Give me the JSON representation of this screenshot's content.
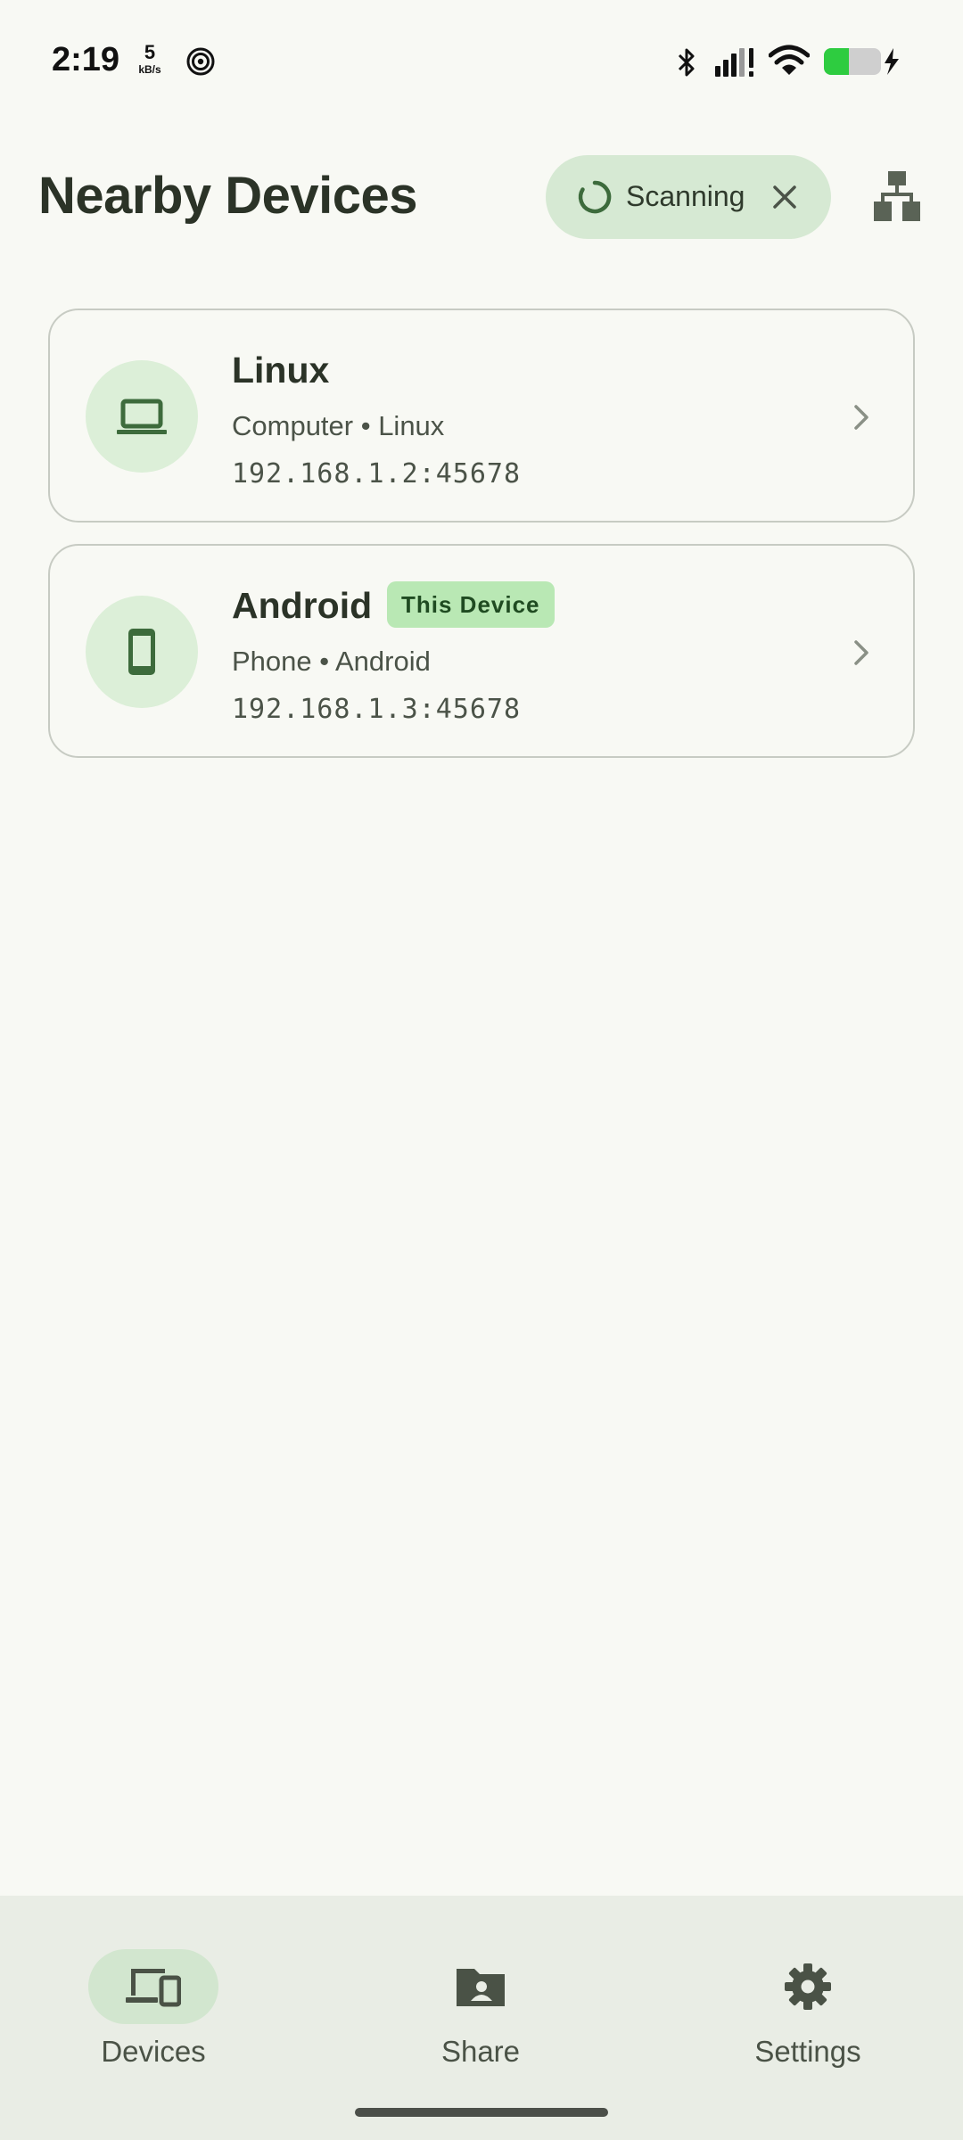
{
  "status_bar": {
    "time": "2:19",
    "net_speed": "5",
    "net_speed_unit": "kB/s"
  },
  "header": {
    "title": "Nearby Devices",
    "scan_label": "Scanning"
  },
  "devices": [
    {
      "name": "Linux",
      "meta": "Computer • Linux",
      "address": "192.168.1.2:45678",
      "icon": "laptop-icon"
    },
    {
      "name": "Android",
      "badge": "This Device",
      "meta": "Phone • Android",
      "address": "192.168.1.3:45678",
      "icon": "phone-icon"
    }
  ],
  "nav": {
    "items": [
      {
        "label": "Devices",
        "icon": "devices-icon",
        "active": true
      },
      {
        "label": "Share",
        "icon": "folder-share-icon",
        "active": false
      },
      {
        "label": "Settings",
        "icon": "gear-icon",
        "active": false
      }
    ]
  },
  "colors": {
    "background": "#f8f9f4",
    "accent": "#d6e9d3",
    "icon_green": "#3d6b3c",
    "badge": "#b9e8b4",
    "battery": "#2ecc40"
  }
}
